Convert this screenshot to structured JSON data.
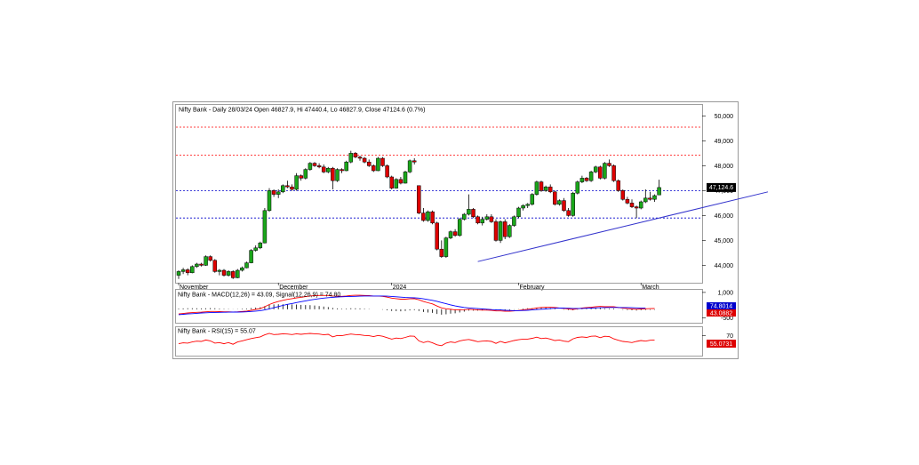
{
  "chart_data": [
    {
      "type": "candlestick",
      "title": "Nifty Bank - Daily 28/03/24 Open 46827.9, Hi 47440.4, Lo 46827.9, Close 47124.6 (0.7%)",
      "ylim": [
        43300,
        50300
      ],
      "y_ticks": [
        {
          "value": 44000,
          "label": "44,000"
        },
        {
          "value": 45000,
          "label": "45,000"
        },
        {
          "value": 46000,
          "label": "46,000"
        },
        {
          "value": 47000,
          "label": "47,000"
        },
        {
          "value": 48000,
          "label": "48,000"
        },
        {
          "value": 49000,
          "label": "49,000"
        },
        {
          "value": 50000,
          "label": "50,000"
        }
      ],
      "x_labels": [
        {
          "index": 0,
          "label": "November"
        },
        {
          "index": 22,
          "label": "December"
        },
        {
          "index": 47,
          "label": "2024"
        },
        {
          "index": 75,
          "label": "February"
        },
        {
          "index": 102,
          "label": "March"
        }
      ],
      "last_close_label": "47,124.6",
      "hlines": [
        {
          "value": 49550,
          "color": "#ff0000",
          "style": "dotted"
        },
        {
          "value": 48430,
          "color": "#ff0000",
          "style": "dotted"
        },
        {
          "value": 47000,
          "color": "#0000cc",
          "style": "dotted"
        },
        {
          "value": 45900,
          "color": "#0000cc",
          "style": "dotted"
        }
      ],
      "trendline": {
        "from": [
          66,
          44150
        ],
        "to": [
          130,
          46950
        ],
        "color": "#3333cc"
      },
      "candles": [
        [
          43600,
          43800,
          43450,
          43750
        ],
        [
          43750,
          43900,
          43650,
          43820
        ],
        [
          43820,
          43880,
          43600,
          43700
        ],
        [
          43700,
          44000,
          43680,
          43950
        ],
        [
          43950,
          44100,
          43900,
          44050
        ],
        [
          44050,
          44100,
          43950,
          44000
        ],
        [
          44000,
          44400,
          43980,
          44350
        ],
        [
          44350,
          44400,
          44150,
          44200
        ],
        [
          44200,
          44250,
          43700,
          43750
        ],
        [
          43750,
          43850,
          43600,
          43800
        ],
        [
          43800,
          43850,
          43550,
          43600
        ],
        [
          43600,
          43800,
          43550,
          43750
        ],
        [
          43750,
          43800,
          43450,
          43500
        ],
        [
          43500,
          43850,
          43480,
          43800
        ],
        [
          43800,
          43950,
          43750,
          43900
        ],
        [
          43900,
          44150,
          43880,
          44100
        ],
        [
          44100,
          44650,
          44080,
          44600
        ],
        [
          44600,
          44800,
          44550,
          44700
        ],
        [
          44700,
          44950,
          44650,
          44900
        ],
        [
          44900,
          46300,
          44880,
          46200
        ],
        [
          46200,
          47100,
          46150,
          47000
        ],
        [
          47000,
          47050,
          46750,
          46850
        ],
        [
          46850,
          47050,
          46700,
          46950
        ],
        [
          46950,
          47250,
          46900,
          47200
        ],
        [
          47200,
          47400,
          47100,
          47150
        ],
        [
          47150,
          47250,
          47000,
          47050
        ],
        [
          47050,
          47700,
          47000,
          47600
        ],
        [
          47600,
          47650,
          47400,
          47500
        ],
        [
          47500,
          47900,
          47450,
          47850
        ],
        [
          47850,
          48150,
          47800,
          48100
        ],
        [
          48100,
          48150,
          47950,
          48000
        ],
        [
          48000,
          48100,
          47900,
          47950
        ],
        [
          47950,
          48050,
          47700,
          47750
        ],
        [
          47750,
          47950,
          47700,
          47900
        ],
        [
          47900,
          47950,
          47050,
          47400
        ],
        [
          47400,
          47900,
          47350,
          47850
        ],
        [
          47850,
          47900,
          47700,
          47800
        ],
        [
          47800,
          48200,
          47780,
          48150
        ],
        [
          48150,
          48600,
          48100,
          48500
        ],
        [
          48500,
          48550,
          48300,
          48350
        ],
        [
          48350,
          48400,
          48200,
          48300
        ],
        [
          48300,
          48350,
          48100,
          48150
        ],
        [
          48150,
          48250,
          47950,
          48000
        ],
        [
          48000,
          48050,
          47750,
          47800
        ],
        [
          47800,
          48350,
          47780,
          48300
        ],
        [
          48300,
          48350,
          47950,
          48000
        ],
        [
          48000,
          48050,
          47500,
          47550
        ],
        [
          47550,
          47600,
          47050,
          47100
        ],
        [
          47100,
          47500,
          47080,
          47450
        ],
        [
          47450,
          47550,
          47250,
          47300
        ],
        [
          47300,
          47800,
          47280,
          47750
        ],
        [
          47750,
          48250,
          47700,
          48200
        ],
        [
          48200,
          48300,
          48050,
          48150
        ],
        [
          47200,
          47200,
          46050,
          46100
        ],
        [
          46100,
          46300,
          45750,
          45800
        ],
        [
          45800,
          46200,
          45750,
          46150
        ],
        [
          46150,
          46200,
          45650,
          45700
        ],
        [
          45700,
          45750,
          44600,
          44650
        ],
        [
          44650,
          45000,
          44300,
          44350
        ],
        [
          44350,
          45150,
          44300,
          45100
        ],
        [
          45100,
          45400,
          45050,
          45350
        ],
        [
          45350,
          45450,
          45150,
          45200
        ],
        [
          45200,
          45900,
          45150,
          45850
        ],
        [
          45850,
          46100,
          45800,
          46050
        ],
        [
          46050,
          46850,
          46000,
          46250
        ],
        [
          46250,
          46300,
          45900,
          45950
        ],
        [
          45950,
          46000,
          45650,
          45700
        ],
        [
          45700,
          45950,
          45600,
          45850
        ],
        [
          45850,
          46050,
          45800,
          45950
        ],
        [
          45950,
          46050,
          45700,
          45750
        ],
        [
          45750,
          45850,
          44950,
          45000
        ],
        [
          45000,
          45800,
          44900,
          45750
        ],
        [
          45750,
          45850,
          45050,
          45150
        ],
        [
          45150,
          45650,
          45100,
          45600
        ],
        [
          45600,
          46000,
          45550,
          45950
        ],
        [
          45950,
          46350,
          45900,
          46300
        ],
        [
          46300,
          46450,
          46200,
          46400
        ],
        [
          46400,
          46500,
          46300,
          46450
        ],
        [
          46450,
          46900,
          46400,
          46850
        ],
        [
          46850,
          47400,
          46800,
          47350
        ],
        [
          47350,
          47400,
          46950,
          47000
        ],
        [
          47000,
          47200,
          46950,
          47150
        ],
        [
          47150,
          47250,
          46900,
          46950
        ],
        [
          46950,
          47000,
          46400,
          46450
        ],
        [
          46450,
          46650,
          46400,
          46600
        ],
        [
          46600,
          46700,
          46150,
          46200
        ],
        [
          46200,
          46300,
          45950,
          46000
        ],
        [
          46000,
          46950,
          45950,
          46900
        ],
        [
          46900,
          47400,
          46850,
          47350
        ],
        [
          47350,
          47600,
          47300,
          47500
        ],
        [
          47500,
          47550,
          47350,
          47400
        ],
        [
          47400,
          47800,
          47350,
          47750
        ],
        [
          47750,
          48000,
          47700,
          47950
        ],
        [
          47950,
          48000,
          47450,
          47500
        ],
        [
          47500,
          48150,
          47450,
          48100
        ],
        [
          48100,
          48250,
          47950,
          48000
        ],
        [
          48000,
          48050,
          47350,
          47400
        ],
        [
          47400,
          47450,
          46950,
          47000
        ],
        [
          47000,
          47050,
          46600,
          46650
        ],
        [
          46650,
          46750,
          46450,
          46500
        ],
        [
          46500,
          46650,
          46300,
          46350
        ],
        [
          46350,
          46400,
          45900,
          46300
        ],
        [
          46300,
          46600,
          46250,
          46550
        ],
        [
          46550,
          47050,
          46500,
          46700
        ],
        [
          46700,
          46950,
          46600,
          46650
        ],
        [
          46650,
          46850,
          46550,
          46800
        ],
        [
          46828,
          47440,
          46828,
          47125
        ]
      ]
    },
    {
      "type": "line",
      "title": "Nifty Bank - MACD(12,26) = 43.09, Signal(12,26,9) = 74.80",
      "ylim": [
        -800,
        1100
      ],
      "y_ticks": [
        {
          "value": 1000,
          "label": "1,000"
        },
        {
          "value": -500,
          "label": "-500"
        }
      ],
      "series": [
        {
          "name": "MACD(12,26)",
          "color": "#ff0000",
          "values": [
            -280,
            -250,
            -220,
            -200,
            -180,
            -170,
            -150,
            -130,
            -130,
            -140,
            -150,
            -150,
            -160,
            -150,
            -130,
            -110,
            -60,
            -10,
            40,
            150,
            280,
            380,
            460,
            530,
            590,
            630,
            680,
            710,
            750,
            790,
            810,
            820,
            820,
            820,
            790,
            780,
            770,
            790,
            820,
            830,
            830,
            820,
            810,
            790,
            790,
            770,
            720,
            660,
            630,
            600,
            600,
            620,
            630,
            560,
            460,
            390,
            320,
            190,
            80,
            30,
            0,
            -40,
            -40,
            -30,
            0,
            -20,
            -40,
            -50,
            -50,
            -60,
            -100,
            -100,
            -120,
            -120,
            -100,
            -70,
            -30,
            0,
            30,
            80,
            110,
            120,
            120,
            110,
            70,
            50,
            20,
            -10,
            30,
            70,
            100,
            120,
            150,
            170,
            150,
            150,
            150,
            110,
            70,
            40,
            20,
            0,
            20,
            30,
            40,
            43
          ]
        },
        {
          "name": "Signal(12,26,9)",
          "color": "#0000ff",
          "values": [
            -320,
            -300,
            -280,
            -260,
            -240,
            -220,
            -210,
            -200,
            -190,
            -180,
            -175,
            -170,
            -168,
            -165,
            -160,
            -150,
            -130,
            -110,
            -80,
            -40,
            20,
            90,
            160,
            230,
            290,
            340,
            400,
            450,
            500,
            550,
            590,
            630,
            660,
            690,
            710,
            730,
            740,
            750,
            760,
            770,
            780,
            790,
            790,
            790,
            790,
            790,
            780,
            760,
            740,
            720,
            700,
            690,
            680,
            660,
            620,
            580,
            530,
            470,
            400,
            330,
            260,
            200,
            150,
            110,
            80,
            60,
            40,
            20,
            0,
            -20,
            -30,
            -40,
            -60,
            -70,
            -80,
            -80,
            -70,
            -60,
            -40,
            -20,
            0,
            20,
            40,
            60,
            70,
            70,
            60,
            50,
            50,
            50,
            60,
            70,
            80,
            90,
            100,
            110,
            110,
            110,
            105,
            100,
            90,
            80,
            78,
            75
          ]
        }
      ],
      "histogram": [
        40,
        50,
        60,
        60,
        60,
        50,
        60,
        70,
        60,
        40,
        25,
        20,
        8,
        15,
        30,
        40,
        70,
        100,
        120,
        190,
        260,
        290,
        300,
        300,
        300,
        290,
        280,
        260,
        250,
        240,
        220,
        190,
        160,
        130,
        80,
        50,
        30,
        40,
        60,
        60,
        50,
        30,
        20,
        0,
        0,
        -20,
        -60,
        -100,
        -110,
        -120,
        -100,
        -70,
        -50,
        -100,
        -160,
        -190,
        -210,
        -280,
        -320,
        -300,
        -260,
        -240,
        -190,
        -140,
        -80,
        -80,
        -80,
        -70,
        -50,
        -40,
        -70,
        -60,
        -60,
        -50,
        -20,
        10,
        40,
        60,
        70,
        100,
        110,
        100,
        80,
        50,
        0,
        -20,
        -40,
        -60,
        -20,
        20,
        40,
        50,
        70,
        80,
        40,
        40,
        45,
        5,
        -30,
        -50,
        -60,
        -75,
        -55,
        -45,
        -35,
        -30
      ]
    },
    {
      "type": "line",
      "title": "Nifty Bank - RSI(15) = 55.07",
      "ylim": [
        0,
        100
      ],
      "y_ticks": [
        {
          "value": 70,
          "label": "70"
        }
      ],
      "last_value_label": "55.0731",
      "series": [
        {
          "name": "RSI(15)",
          "color": "#ff0000",
          "values": [
            42,
            45,
            44,
            48,
            51,
            50,
            55,
            52,
            44,
            46,
            42,
            46,
            40,
            48,
            52,
            56,
            60,
            63,
            66,
            73,
            78,
            74,
            75,
            77,
            76,
            74,
            77,
            75,
            77,
            78,
            77,
            76,
            73,
            75,
            66,
            71,
            70,
            73,
            76,
            74,
            73,
            71,
            70,
            67,
            71,
            68,
            63,
            58,
            62,
            60,
            64,
            69,
            68,
            52,
            46,
            50,
            45,
            38,
            35,
            44,
            48,
            46,
            52,
            55,
            57,
            53,
            49,
            51,
            52,
            50,
            43,
            50,
            45,
            49,
            53,
            56,
            58,
            58,
            61,
            65,
            60,
            62,
            58,
            53,
            55,
            51,
            49,
            59,
            64,
            66,
            64,
            68,
            69,
            63,
            68,
            67,
            59,
            54,
            50,
            48,
            46,
            50,
            53,
            51,
            54,
            55
          ]
        }
      ]
    }
  ]
}
